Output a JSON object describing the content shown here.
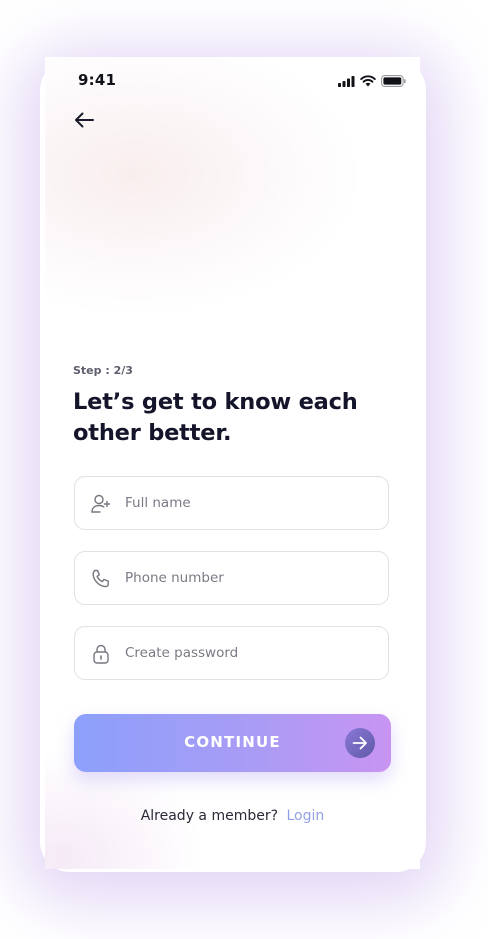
{
  "status_bar": {
    "time": "9:41"
  },
  "icons": {
    "back": "arrow-left-icon",
    "signal": "cellular-signal-icon",
    "wifi": "wifi-icon",
    "battery": "battery-icon",
    "user": "user-plus-icon",
    "phone": "phone-icon",
    "lock": "lock-icon",
    "continue": "arrow-right-icon"
  },
  "step_label": "Step : 2/3",
  "headline": "Let’s get to know each other better.",
  "fields": {
    "full_name": {
      "placeholder": "Full name",
      "value": ""
    },
    "phone_number": {
      "placeholder": "Phone number",
      "value": ""
    },
    "password": {
      "placeholder": "Create password",
      "value": ""
    }
  },
  "continue_button": {
    "label": "CONTINUE"
  },
  "footer": {
    "prompt": "Already a member?",
    "login_link": "Login"
  },
  "colors": {
    "accent_gradient_start": "#8ca0fb",
    "accent_gradient_end": "#c894f2",
    "link": "#93a2e8",
    "headline": "#14142a"
  }
}
